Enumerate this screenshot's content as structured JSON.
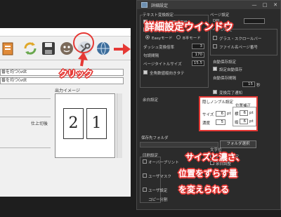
{
  "annotations": {
    "click": "クリック",
    "detail_window": "詳細設定ウインドウ",
    "note_line1": "サイズと濃さ、",
    "note_line2": "位置をずらす量",
    "note_line3": "を変えられる"
  },
  "background_window": {
    "fields": [
      "番を均つ(vdt",
      "番を均つ(vdt"
    ],
    "preview_label": "出力イメージ",
    "side_text": "仕上切後",
    "pages": [
      "2",
      "1"
    ],
    "toolbar_icons": [
      "app-icon",
      "refresh-icon",
      "save-icon",
      "face-icon",
      "settings-icon",
      "globe-icon"
    ]
  },
  "dialog": {
    "title": "詳細設定",
    "window_controls": {
      "minimize": "—",
      "maximize": "□",
      "close": "✕"
    },
    "left": {
      "text_convert_label": "テキスト変換設定",
      "dash_convert": "ダッシュ→—罫線変換",
      "half_full_convert": "全角・半角変換設定",
      "radio_easy": "Easyモード",
      "radio_fixed": "B半モード",
      "dash_count_label": "ダッシュ変換倍率",
      "dash_count": "3",
      "margin_label": "句読間隔",
      "margin": "170",
      "page_size_label": "ページタイトルサイズ",
      "page_size": "15.5",
      "full_font": "全角数値縦向きタテ"
    },
    "right": {
      "page_settings": "ページ設定",
      "dpi_label": "DPI",
      "page_items_label": "ページ設定",
      "glass_color": "グラス・スクロールバー",
      "file_name_page": "ファイル名ページ番号",
      "auto_save_label": "自動保存設定",
      "auto_save_check": "設定自動保存",
      "autosave_interval_label": "自動保存間隔",
      "autosave_interval": "15",
      "autosave_unit": "秒",
      "complete_notify": "変換完了通知"
    },
    "misc_settings": "余白設定",
    "bleed_group": {
      "title": "隠しノンブル設定",
      "pos_label": "位置補正",
      "size_label": "サイズ",
      "size_value": "6",
      "density_label": "濃度",
      "density_value": "5",
      "horiz_label": "横",
      "horiz_value": "6",
      "vert_label": "縦",
      "vert_value": "6",
      "unit": "pt"
    },
    "output_folder_label": "保存先フォルダ",
    "folder_button": "フォルダ選択",
    "bottom_left": {
      "title": "印刷設定",
      "overprint": "オーバープリント",
      "user_mask": "ユーザマスク",
      "user_preset": "ユーザ設定",
      "copy_count": "コピー分割"
    },
    "bottom_right": {
      "title": "文字位",
      "item1": "ノンブル設定",
      "item2": "余白調整"
    }
  },
  "colors": {
    "accent_red": "#e53935",
    "dialog_bg": "#2b2b2b",
    "background_window": "#f0f0f0"
  }
}
